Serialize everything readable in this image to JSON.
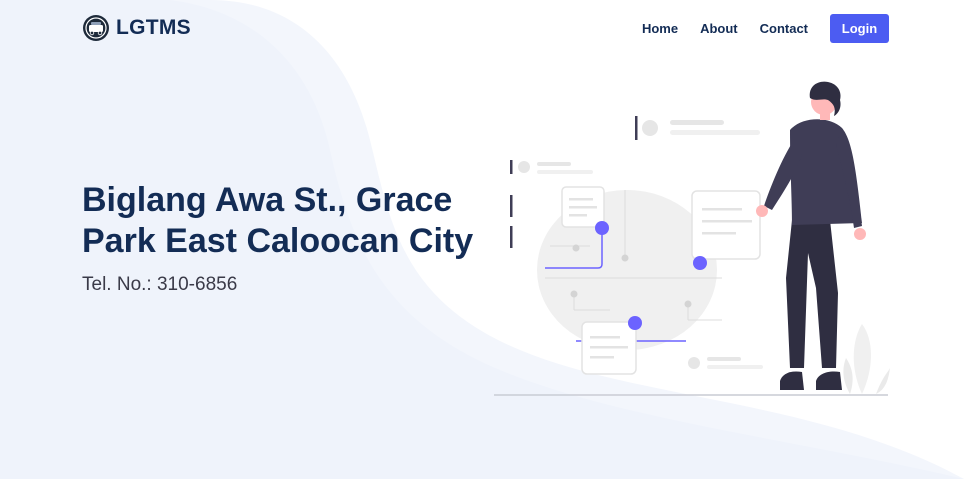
{
  "brand": {
    "name": "LGTMS",
    "logo_icon": "seal-logo-icon"
  },
  "nav": {
    "home_label": "Home",
    "about_label": "About",
    "contact_label": "Contact",
    "login_label": "Login"
  },
  "hero": {
    "address": "Biglang Awa St., Grace Park East Caloocan City",
    "telephone": "Tel. No.: 310-6856"
  },
  "colors": {
    "brand_text": "#132C55",
    "accent": "#4C5CF2",
    "background_wave": "#F1F4FB"
  }
}
